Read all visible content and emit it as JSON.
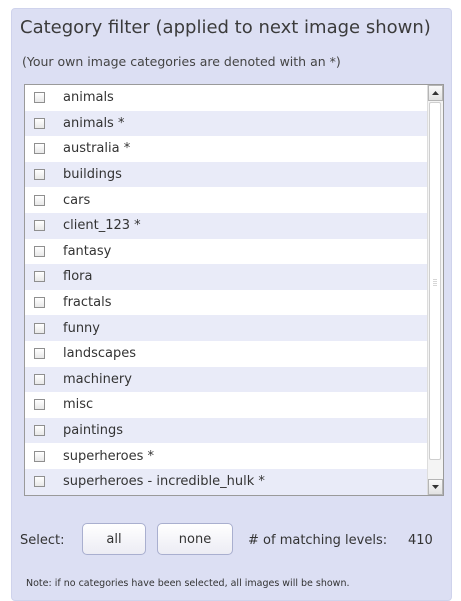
{
  "panel": {
    "title": "Category filter (applied to next image shown)",
    "subtitle": "(Your own image categories are denoted with an *)"
  },
  "categories": [
    {
      "label": "animals",
      "checked": false
    },
    {
      "label": "animals *",
      "checked": false
    },
    {
      "label": "australia *",
      "checked": false
    },
    {
      "label": "buildings",
      "checked": false
    },
    {
      "label": "cars",
      "checked": false
    },
    {
      "label": "client_123 *",
      "checked": false
    },
    {
      "label": "fantasy",
      "checked": false
    },
    {
      "label": "flora",
      "checked": false
    },
    {
      "label": "fractals",
      "checked": false
    },
    {
      "label": "funny",
      "checked": false
    },
    {
      "label": "landscapes",
      "checked": false
    },
    {
      "label": "machinery",
      "checked": false
    },
    {
      "label": "misc",
      "checked": false
    },
    {
      "label": "paintings",
      "checked": false
    },
    {
      "label": "superheroes *",
      "checked": false
    },
    {
      "label": "superheroes - incredible_hulk *",
      "checked": false
    }
  ],
  "controls": {
    "select_label": "Select:",
    "all_label": "all",
    "none_label": "none",
    "matching_label": "# of matching levels:",
    "matching_value": "410"
  },
  "note": "Note: if no categories have been selected, all images will be shown.",
  "icons": {
    "scroll_up": "scroll-up-arrow-icon",
    "scroll_down": "scroll-down-arrow-icon"
  },
  "colors": {
    "panel_background": "#dcdff3",
    "alt_row_background": "#e9ebf8",
    "button_border": "#a9afcf"
  }
}
